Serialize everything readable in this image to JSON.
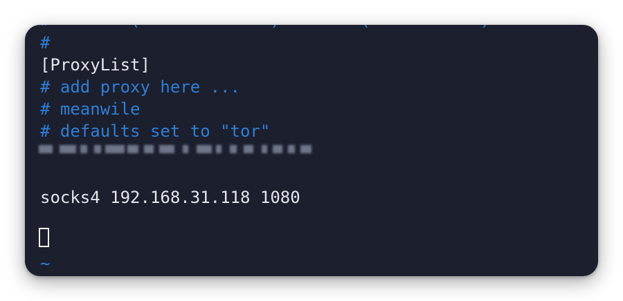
{
  "editor": {
    "cutoff_line": "#        (             )        (           )",
    "lines": {
      "hash": "#",
      "proxylist": "[ProxyList]",
      "comment_add": "# add proxy here ...",
      "comment_meanwile": "# meanwile",
      "comment_defaults": "# defaults set to \"tor\"",
      "socks": "socks4 192.168.31.118 1080",
      "tilde": "~"
    },
    "blurred_line_note": "",
    "colors": {
      "background": "#1c1f2e",
      "comment": "#2f7fd4",
      "text": "#e4e6ee"
    }
  }
}
